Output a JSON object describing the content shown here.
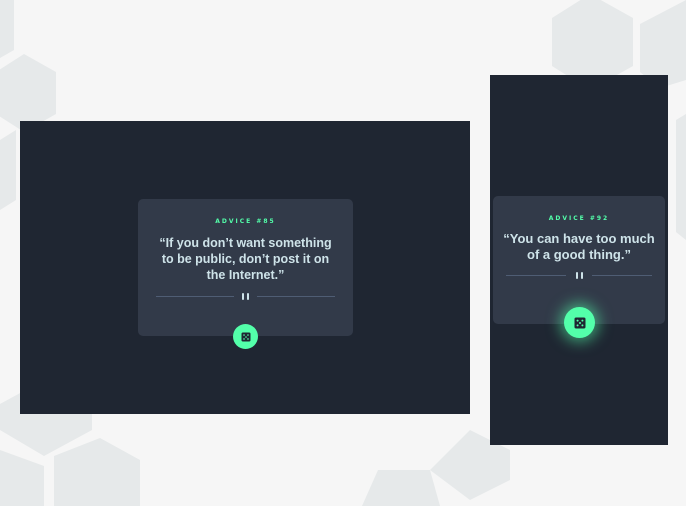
{
  "desktop": {
    "advice_label": "ADVICE #85",
    "quote": "“If you don’t want something to be public, don’t post it on the Internet.”"
  },
  "mobile": {
    "advice_label": "ADVICE #92",
    "quote": "“You can have too much of a good thing.”"
  },
  "icons": {
    "divider": "pause-icon",
    "button": "dice-icon"
  },
  "colors": {
    "accent": "#53ffaa",
    "background": "#1f2632",
    "card": "#323a49",
    "text": "#cee3e9"
  }
}
